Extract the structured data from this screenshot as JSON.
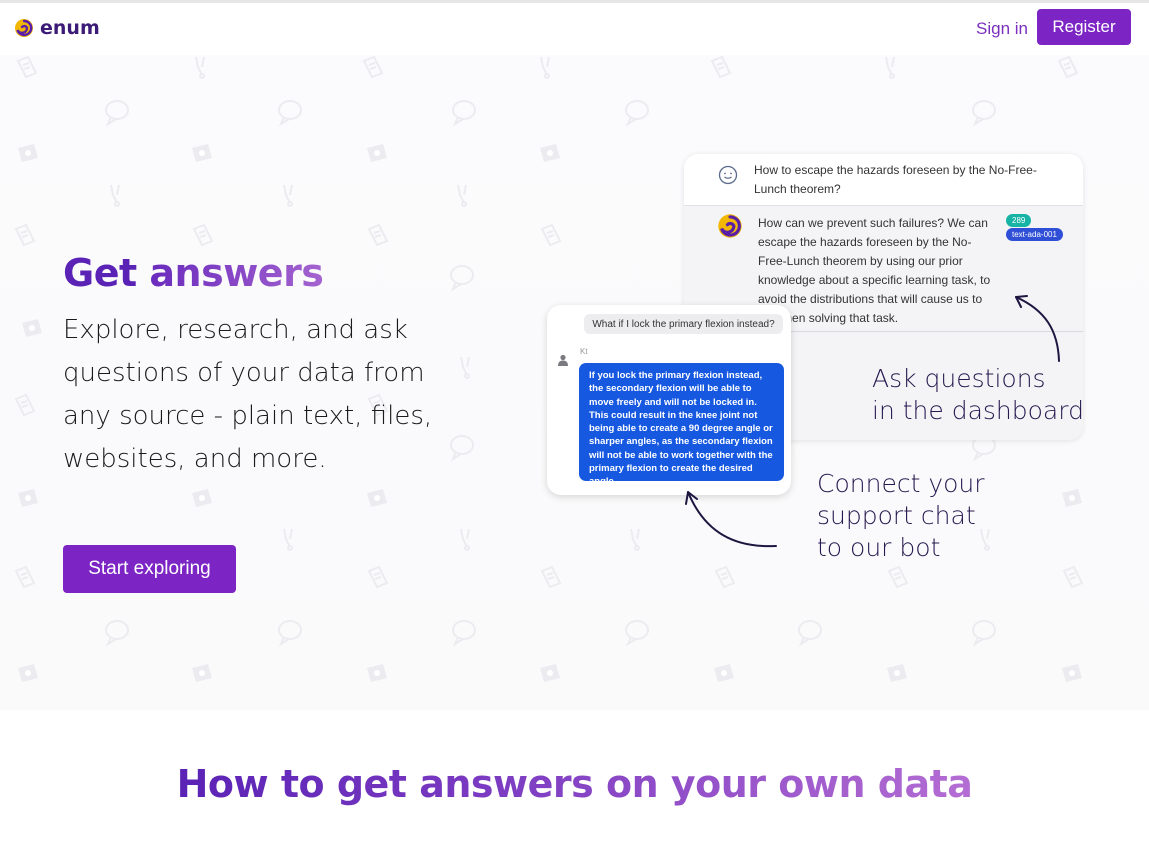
{
  "header": {
    "brand": "enum",
    "signin_label": "Sign in",
    "register_label": "Register"
  },
  "hero": {
    "title_part1": "Get",
    "title_part2": "answers",
    "text": "Explore, research, and ask questions of your data from any source - plain text, files, websites, and more.",
    "cta_label": "Start exploring"
  },
  "dashboard": {
    "question": "How to escape the hazards foreseen by the No-Free-Lunch theorem?",
    "answer": "How can we prevent such failures? We can escape the hazards foreseen by the No-Free-Lunch theorem by using our prior knowledge about a specific learning task, to avoid the distributions that will cause us to fail when solving that task.",
    "token_badge": "289",
    "model_badge": "text-ada-001",
    "caption_line1": "Ask questions",
    "caption_line2": "in the dashboard"
  },
  "support_chat": {
    "question": "What if I lock the primary flexion instead?",
    "user_name": "Kt",
    "answer": "If you lock the primary flexion instead, the secondary flexion will be able to move freely and will not be locked in. This could result in the knee joint not being able to create a 90 degree angle or sharper angles, as the secondary flexion will not be able to work together with the primary flexion to create the desired angle.",
    "caption_line1": "Connect your",
    "caption_line2": "support chat",
    "caption_line3": "to our bot"
  },
  "section": {
    "title": "How to get answers on your own data"
  },
  "colors": {
    "brand_purple": "#7d24c5",
    "heading_purple": "#5a22b5",
    "chat_blue": "#1659e0",
    "badge_teal": "#17b3a5",
    "badge_blue": "#2f4fd6"
  }
}
